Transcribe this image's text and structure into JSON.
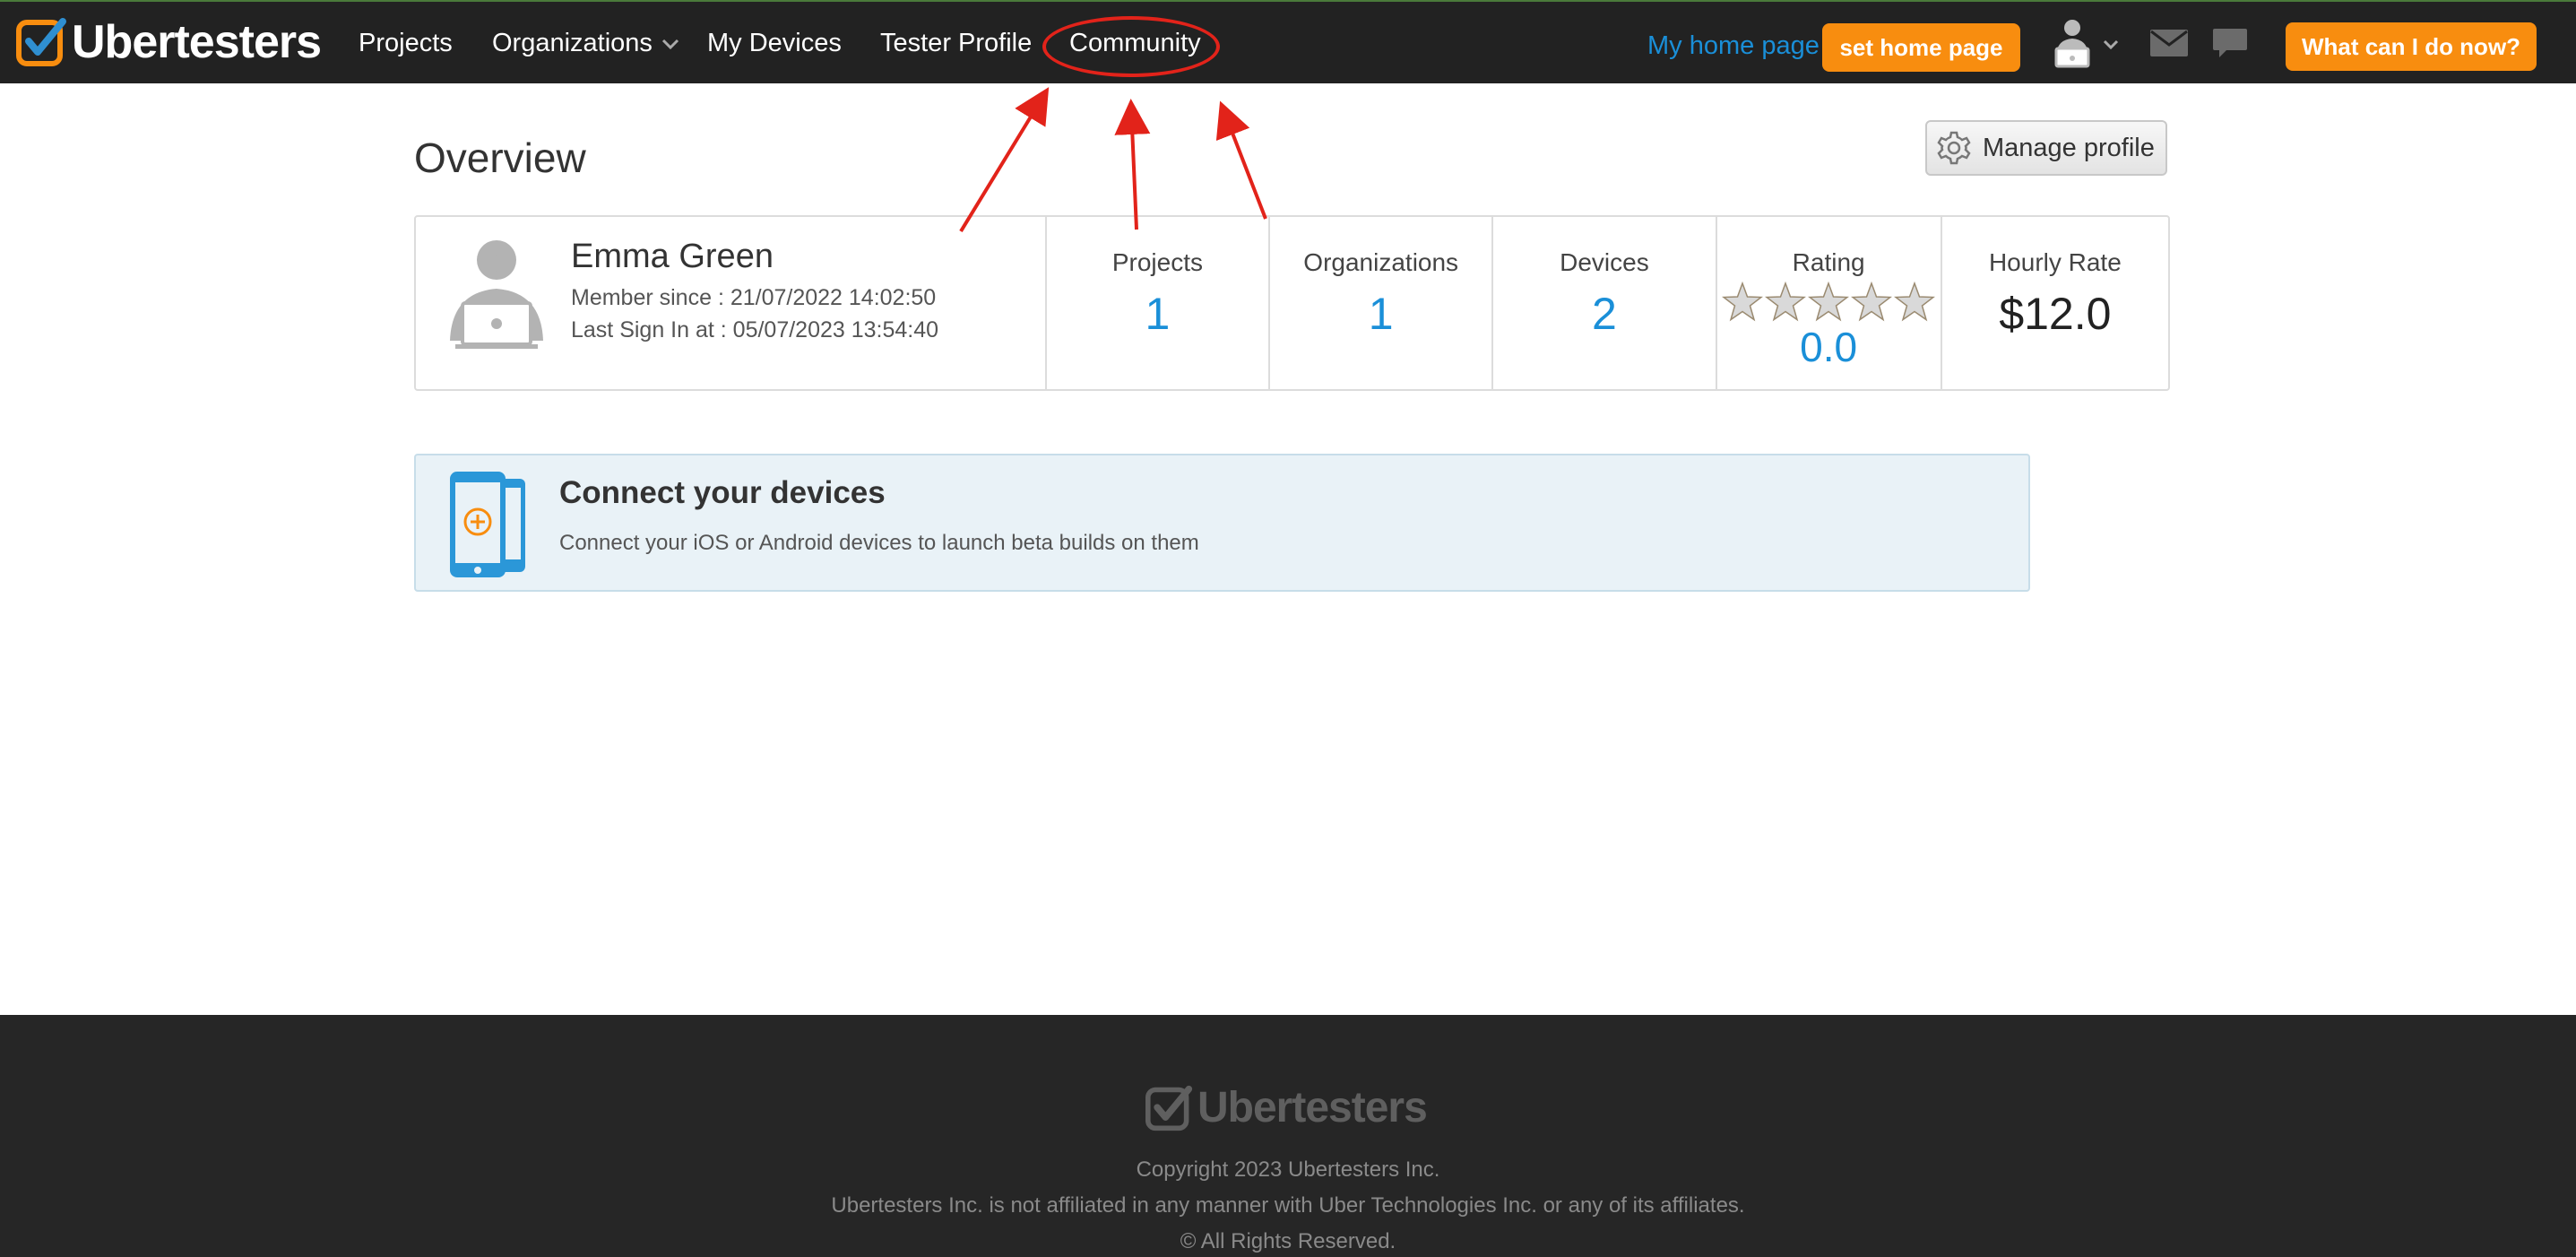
{
  "brand": {
    "name": "Ubertesters"
  },
  "nav": {
    "items": [
      {
        "label": "Projects"
      },
      {
        "label": "Organizations"
      },
      {
        "label": "My Devices"
      },
      {
        "label": "Tester Profile"
      },
      {
        "label": "Community"
      }
    ],
    "home_link": "My home page",
    "set_home_button": "set home page",
    "help_button": "What can I do now?"
  },
  "page": {
    "title": "Overview",
    "manage_profile_button": "Manage profile"
  },
  "profile": {
    "name": "Emma Green",
    "member_since": "Member since : 21/07/2022 14:02:50",
    "last_sign_in": "Last Sign In at : 05/07/2023 13:54:40"
  },
  "stats": {
    "projects": {
      "label": "Projects",
      "value": "1"
    },
    "organizations": {
      "label": "Organizations",
      "value": "1"
    },
    "devices": {
      "label": "Devices",
      "value": "2"
    },
    "rating": {
      "label": "Rating",
      "value": "0.0",
      "stars_filled": 0,
      "stars_total": 5
    },
    "hourly_rate": {
      "label": "Hourly Rate",
      "value": "$12.0"
    }
  },
  "connect": {
    "title": "Connect your devices",
    "description": "Connect your iOS or Android devices to launch beta builds on them"
  },
  "footer": {
    "brand": "Ubertesters",
    "copyright": "Copyright 2023 Ubertesters Inc.",
    "disclaimer": "Ubertesters Inc. is not affiliated in any manner with Uber Technologies Inc. or any of its affiliates.",
    "rights": "© All Rights Reserved."
  },
  "colors": {
    "topbar": "#222222",
    "accent_orange": "#f88d0f",
    "link_blue": "#1a8fd8",
    "annotation_red": "#e2231a",
    "connect_bg": "#e9f2f7",
    "footer_bg": "#262626"
  },
  "icons": {
    "logo": "check-box-icon",
    "user_menu": "user-laptop-icon",
    "messages": "mail-icon",
    "chat": "chat-bubble-icon",
    "manage": "gear-icon",
    "rating": "star-icon",
    "connect": "phones-plus-icon"
  }
}
